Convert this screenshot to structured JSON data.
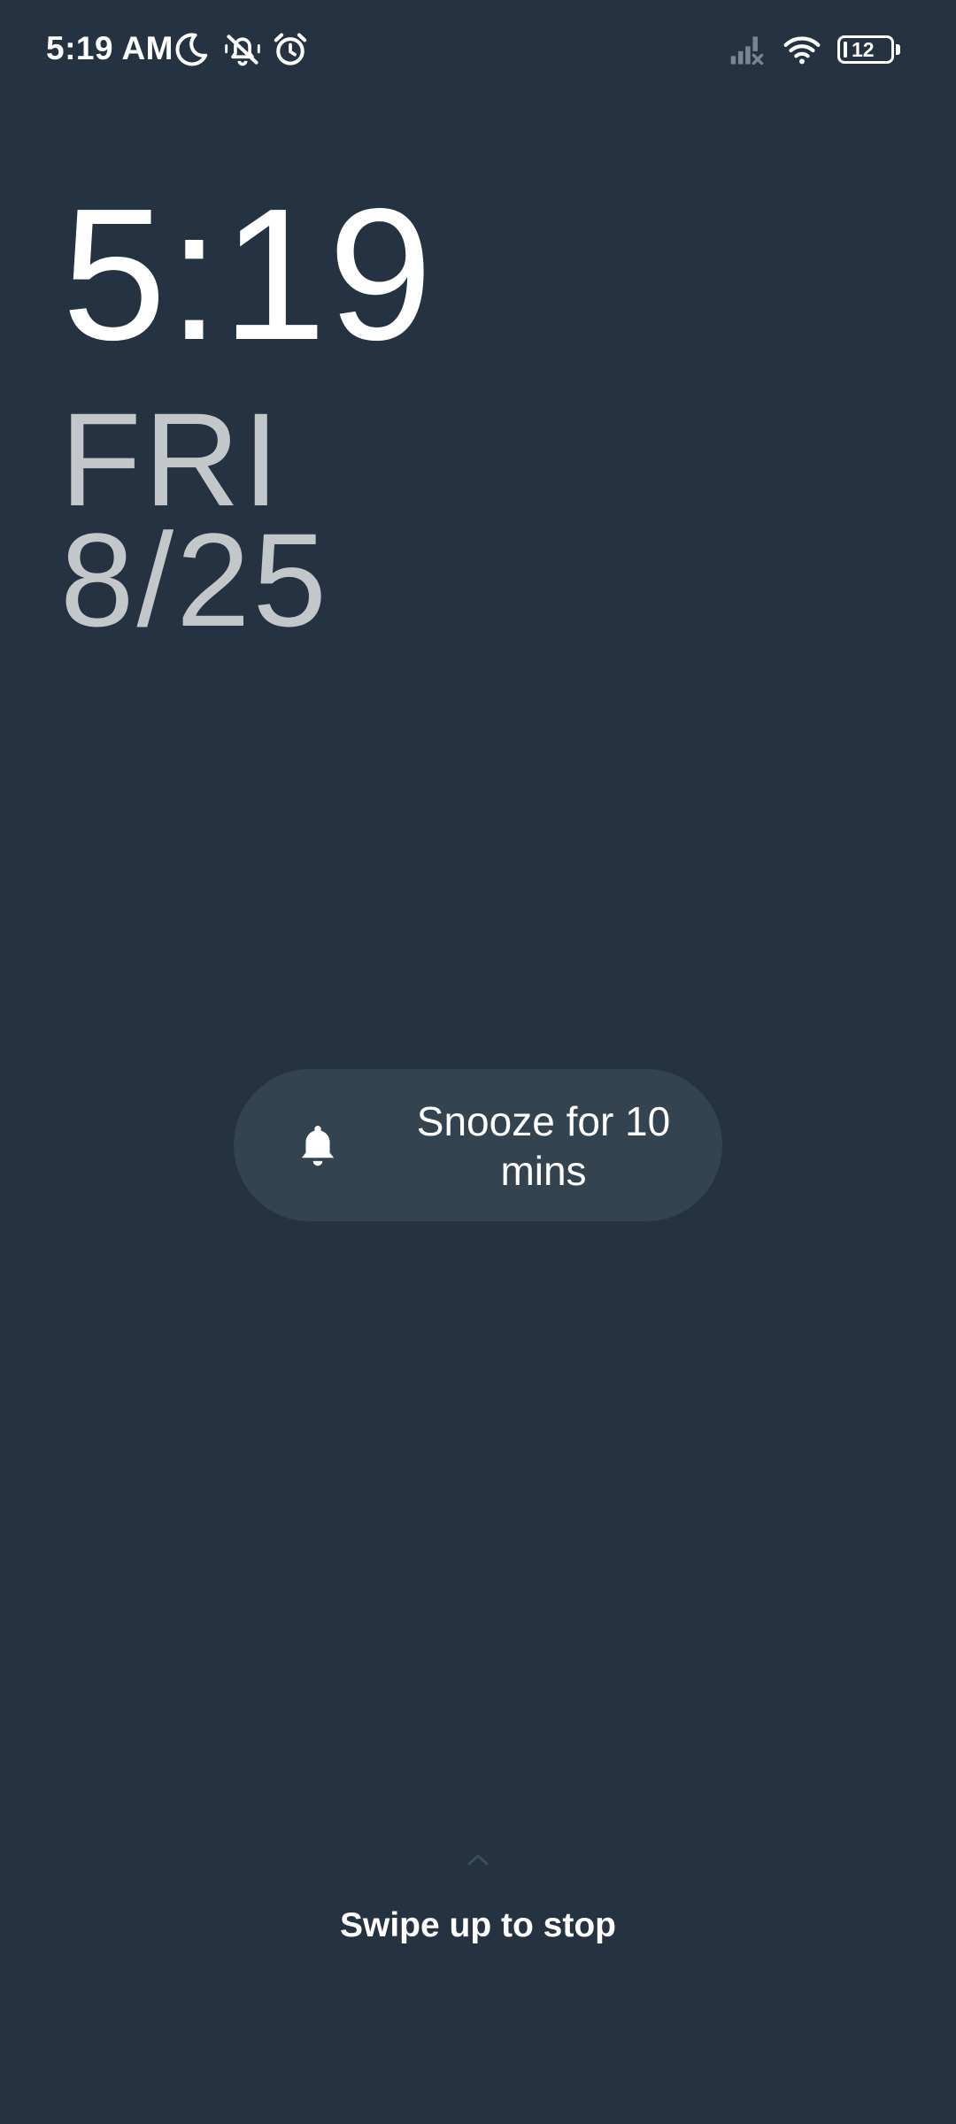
{
  "status_bar": {
    "time": "5:19 AM",
    "icons": [
      "moon-icon",
      "bell-off-icon",
      "alarm-clock-icon",
      "signal-no-service-icon",
      "wifi-icon"
    ],
    "battery_level": "12"
  },
  "clock": {
    "time": "5:19",
    "day": "FRI",
    "date": "8/25"
  },
  "snooze": {
    "icon": "bell-icon",
    "label": "Snooze for 10 mins"
  },
  "swipe": {
    "icon": "chevron-up-icon",
    "label": "Swipe up to stop"
  },
  "colors": {
    "background": "#243241",
    "snooze_background": "#33434f",
    "date_text": "#c4c7c9"
  }
}
